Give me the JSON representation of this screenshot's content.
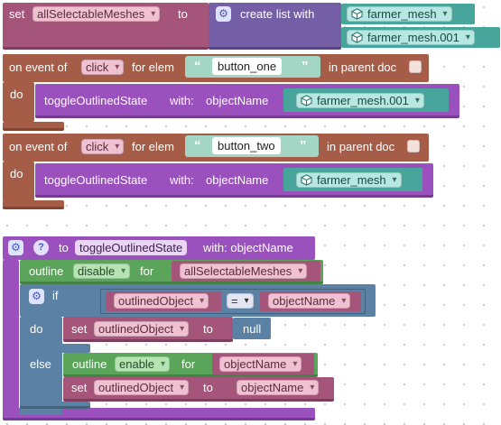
{
  "stack1": {
    "set_label": "set",
    "var_name": "allSelectableMeshes",
    "to_label": "to",
    "create_list_label": "create list with",
    "items": [
      "farmer_mesh",
      "farmer_mesh.001"
    ]
  },
  "events": [
    {
      "on_event_label": "on event of",
      "event_name": "click",
      "for_elem_label": "for elem",
      "button_name": "button_one",
      "in_parent_doc_label": "in parent doc",
      "do_label": "do",
      "call_label": "toggleOutlinedState",
      "with_label": "with:",
      "param_label": "objectName",
      "mesh": "farmer_mesh.001"
    },
    {
      "on_event_label": "on event of",
      "event_name": "click",
      "for_elem_label": "for elem",
      "button_name": "button_two",
      "in_parent_doc_label": "in parent doc",
      "do_label": "do",
      "call_label": "toggleOutlinedState",
      "with_label": "with:",
      "param_label": "objectName",
      "mesh": "farmer_mesh"
    }
  ],
  "function": {
    "to_label": "to",
    "func_name": "toggleOutlinedState",
    "with_label": "with: objectName",
    "outline_label": "outline",
    "disable_option": "disable",
    "for_label": "for",
    "list_var": "allSelectableMeshes",
    "if_label": "if",
    "outlined_object": "outlinedObject",
    "eq_operator": "=",
    "object_name": "objectName",
    "do_label": "do",
    "set_label": "set",
    "to_word": "to",
    "null_value": "null",
    "else_label": "else",
    "enable_option": "enable"
  },
  "colors": {
    "variable": "#a5547a",
    "list": "#745ea5",
    "event": "#a55d47",
    "procedure": "#9a50bd",
    "logic": "#5b81a5",
    "outline": "#5ba55b"
  },
  "icons": {
    "mesh": "cube-icon",
    "gear": "gear-icon",
    "help": "question-icon"
  }
}
